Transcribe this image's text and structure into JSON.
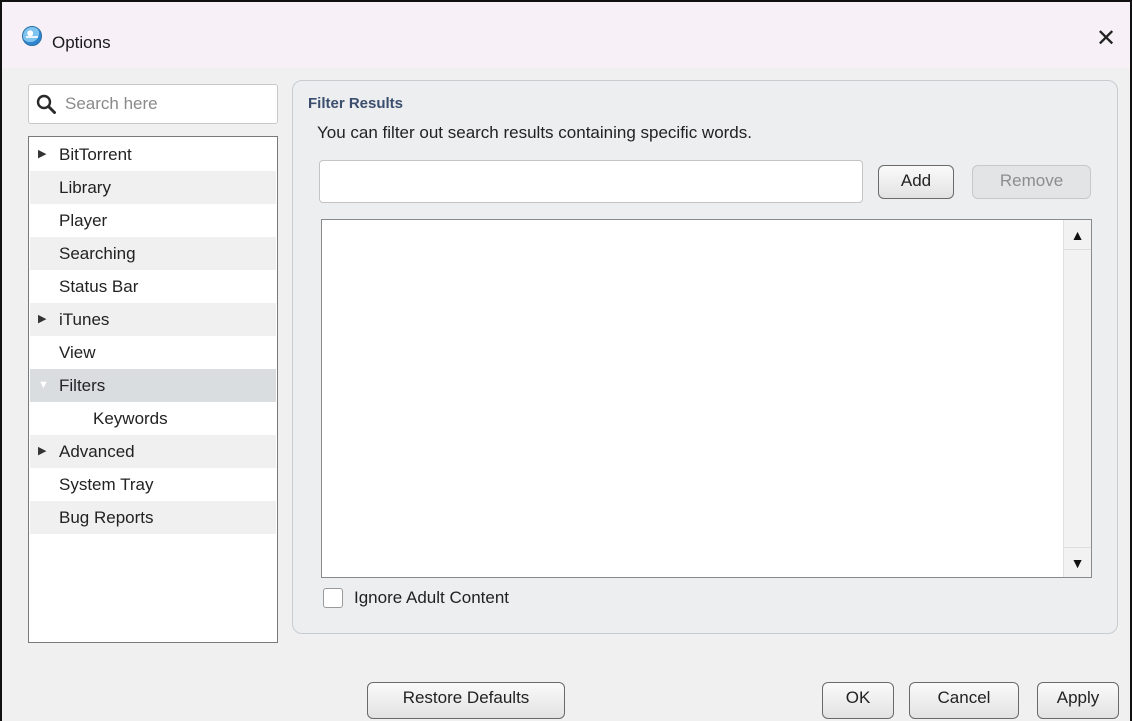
{
  "window": {
    "title": "Options",
    "close_glyph": "✕",
    "app_icon": "globe-icon"
  },
  "search": {
    "placeholder": "Search here",
    "value": ""
  },
  "nav": {
    "items": [
      {
        "label": "BitTorrent",
        "expander": "▶"
      },
      {
        "label": "Library"
      },
      {
        "label": "Player"
      },
      {
        "label": "Searching"
      },
      {
        "label": "Status Bar"
      },
      {
        "label": "iTunes",
        "expander": "▶"
      },
      {
        "label": "View"
      },
      {
        "label": "Filters",
        "expander": "▼",
        "selected": true
      },
      {
        "label": "Keywords"
      },
      {
        "label": "Advanced",
        "expander": "▶"
      },
      {
        "label": "System Tray"
      },
      {
        "label": "Bug Reports"
      }
    ]
  },
  "panel": {
    "title": "Filter Results",
    "description": "You can filter out search results containing specific words.",
    "keyword_input_value": "",
    "add_label": "Add",
    "remove_label": "Remove",
    "scroll_up": "▲",
    "scroll_down": "▼",
    "ignore_adult_label": "Ignore Adult Content",
    "ignore_adult_checked": false
  },
  "footer": {
    "restore_label": "Restore Defaults",
    "ok_label": "OK",
    "cancel_label": "Cancel",
    "apply_label": "Apply"
  }
}
